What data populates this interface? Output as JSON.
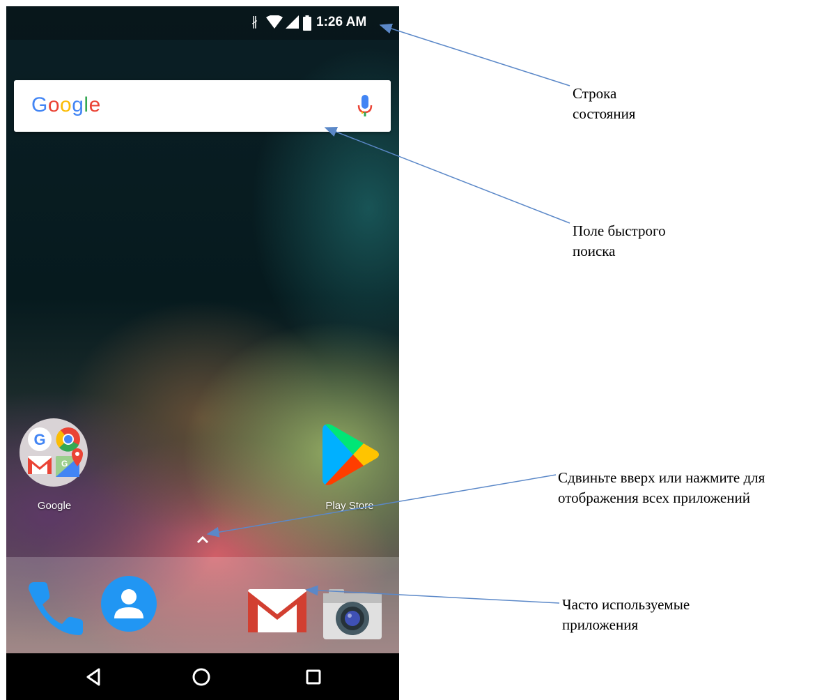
{
  "status_bar": {
    "time": "1:26 AM",
    "icons": [
      "bluetooth-icon",
      "wifi-icon",
      "signal-icon",
      "battery-icon"
    ]
  },
  "search_bar": {
    "logo_text": [
      "G",
      "o",
      "o",
      "g",
      "l",
      "e"
    ],
    "mic_icon": "mic-icon"
  },
  "home_apps": [
    {
      "label": "Google",
      "icon": "google-folder-icon"
    },
    {
      "label": "Play Store",
      "icon": "play-store-icon"
    }
  ],
  "dock_apps": [
    {
      "name": "phone",
      "icon": "phone-icon"
    },
    {
      "name": "contacts",
      "icon": "contacts-icon"
    },
    {
      "name": "gmail",
      "icon": "gmail-icon"
    },
    {
      "name": "camera",
      "icon": "camera-icon"
    }
  ],
  "nav_bar": [
    "back-icon",
    "home-icon",
    "recents-icon"
  ],
  "annotations": {
    "status_bar": [
      "Строка",
      "состояния"
    ],
    "search_box": [
      "Поле быстрого",
      "поиска"
    ],
    "all_apps": [
      "Сдвиньте вверх или нажмите для",
      "отображения всех приложений"
    ],
    "favorites": [
      "Часто используемые",
      "приложения"
    ]
  },
  "colors": {
    "annotation_arrow": "#5b88c8",
    "google_blue": "#4285f4",
    "google_red": "#ea4335",
    "google_yellow": "#fbbc05",
    "google_green": "#34a853"
  }
}
